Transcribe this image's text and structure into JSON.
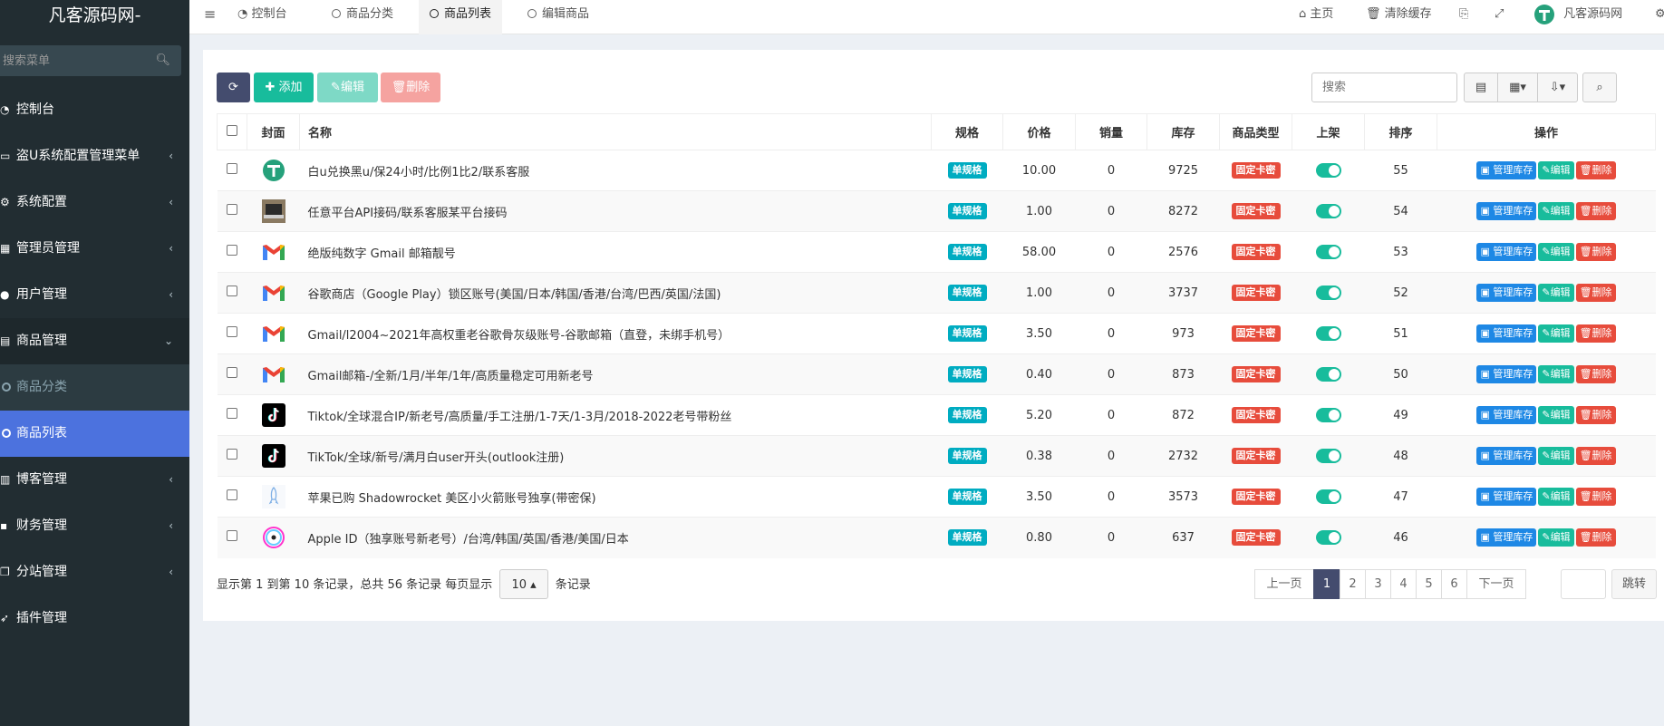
{
  "app": {
    "title": "凡客源码网-"
  },
  "sidebar": {
    "search_placeholder": "搜索菜单",
    "items": [
      {
        "label": "控制台"
      },
      {
        "label": "盗U系统配置管理菜单"
      },
      {
        "label": "系统配置"
      },
      {
        "label": "管理员管理"
      },
      {
        "label": "用户管理"
      },
      {
        "label": "商品管理"
      },
      {
        "label": "博客管理"
      },
      {
        "label": "财务管理"
      },
      {
        "label": "分站管理"
      },
      {
        "label": "插件管理"
      }
    ],
    "submenu": [
      {
        "label": "商品分类"
      },
      {
        "label": "商品列表"
      }
    ]
  },
  "topbar": {
    "tabs": [
      {
        "label": "控制台"
      },
      {
        "label": "商品分类"
      },
      {
        "label": "商品列表"
      },
      {
        "label": "编辑商品"
      }
    ],
    "home_label": "主页",
    "clear_cache_label": "清除缓存",
    "site_label": "凡客源码网"
  },
  "toolbar": {
    "add_label": "添加",
    "edit_label": "编辑",
    "delete_label": "删除",
    "search_placeholder": "搜索"
  },
  "table": {
    "headers": [
      "封面",
      "名称",
      "规格",
      "价格",
      "销量",
      "库存",
      "商品类型",
      "上架",
      "排序",
      "操作"
    ],
    "rows": [
      {
        "cover": "tether",
        "name": "白u兑换黑u/保24小时/比例1比2/联系客服",
        "spec": "单规格",
        "price": "10.00",
        "sales": "0",
        "stock": "9725",
        "type": "固定卡密",
        "sort": "55"
      },
      {
        "cover": "laptop",
        "name": "任意平台API接码/联系客服某平台接码",
        "spec": "单规格",
        "price": "1.00",
        "sales": "0",
        "stock": "8272",
        "type": "固定卡密",
        "sort": "54"
      },
      {
        "cover": "gmail",
        "name": "绝版纯数字 Gmail 邮箱靓号",
        "spec": "单规格",
        "price": "58.00",
        "sales": "0",
        "stock": "2576",
        "type": "固定卡密",
        "sort": "53"
      },
      {
        "cover": "gmail",
        "name": "谷歌商店（Google Play）锁区账号(美国/日本/韩国/香港/台湾/巴西/英国/法国)",
        "spec": "单规格",
        "price": "1.00",
        "sales": "0",
        "stock": "3737",
        "type": "固定卡密",
        "sort": "52"
      },
      {
        "cover": "gmail",
        "name": "Gmail/l2004~2021年高权重老谷歌骨灰级账号-谷歌邮箱（直登，未绑手机号）",
        "spec": "单规格",
        "price": "3.50",
        "sales": "0",
        "stock": "973",
        "type": "固定卡密",
        "sort": "51"
      },
      {
        "cover": "gmail",
        "name": "Gmail邮箱-/全新/1月/半年/1年/高质量稳定可用新老号",
        "spec": "单规格",
        "price": "0.40",
        "sales": "0",
        "stock": "873",
        "type": "固定卡密",
        "sort": "50"
      },
      {
        "cover": "tiktok",
        "name": "Tiktok/全球混合IP/新老号/高质量/手工注册/1-7天/1-3月/2018-2022老号带粉丝",
        "spec": "单规格",
        "price": "5.20",
        "sales": "0",
        "stock": "872",
        "type": "固定卡密",
        "sort": "49"
      },
      {
        "cover": "tiktok",
        "name": "TikTok/全球/新号/满月白user开头(outlook注册)",
        "spec": "单规格",
        "price": "0.38",
        "sales": "0",
        "stock": "2732",
        "type": "固定卡密",
        "sort": "48"
      },
      {
        "cover": "rocket",
        "name": "苹果已购 Shadowrocket 美区小火箭账号独享(带密保)",
        "spec": "单规格",
        "price": "3.50",
        "sales": "0",
        "stock": "3573",
        "type": "固定卡密",
        "sort": "47"
      },
      {
        "cover": "appleid",
        "name": "Apple ID（独享账号新老号）/台湾/韩国/英国/香港/美国/日本",
        "spec": "单规格",
        "price": "0.80",
        "sales": "0",
        "stock": "637",
        "type": "固定卡密",
        "sort": "46"
      }
    ],
    "actions": {
      "stock": "管理库存",
      "edit": "编辑",
      "delete": "删除"
    }
  },
  "footer": {
    "info_prefix": "显示第 1 到第 10 条记录，总共 56 条记录 每页显示",
    "page_size": "10",
    "info_suffix": "条记录",
    "pages": [
      "上一页",
      "1",
      "2",
      "3",
      "4",
      "5",
      "6",
      "下一页"
    ],
    "jump_label": "跳转"
  }
}
